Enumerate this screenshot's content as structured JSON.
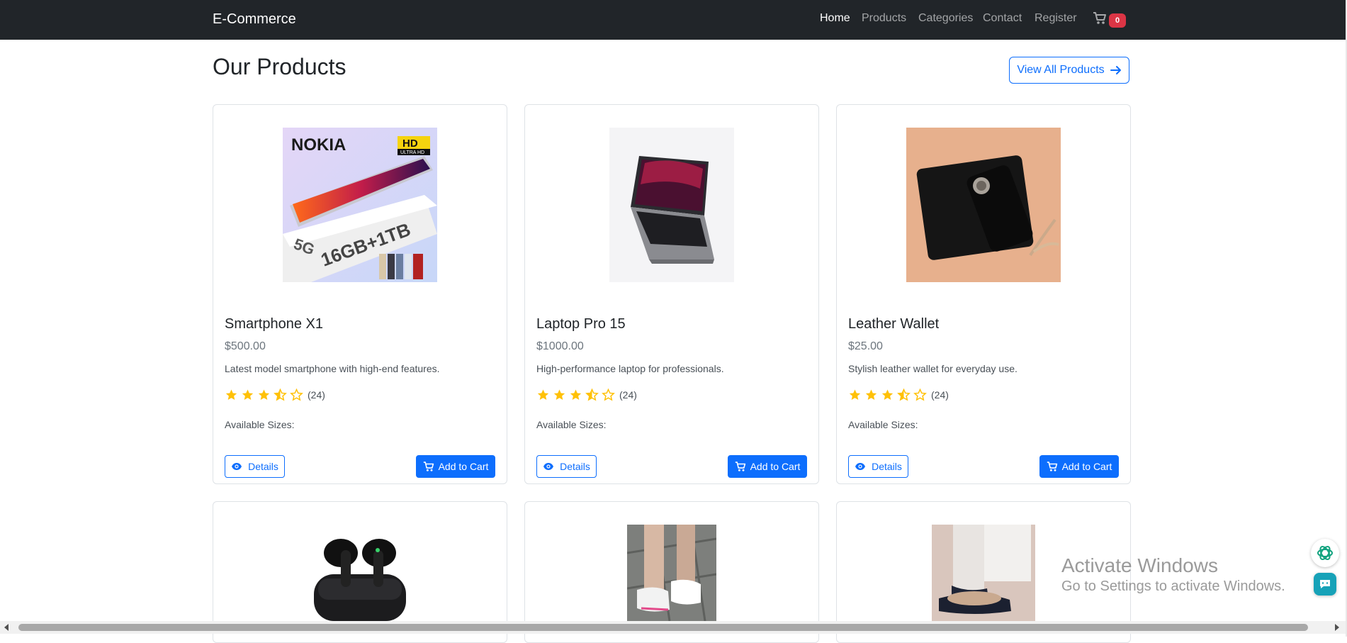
{
  "navbar": {
    "brand": "E-Commerce",
    "links": [
      {
        "label": "Home"
      },
      {
        "label": "Products"
      },
      {
        "label": "Categories"
      },
      {
        "label": "Contact"
      },
      {
        "label": "Register"
      }
    ],
    "cart_count": "0"
  },
  "header": {
    "title": "Our Products",
    "view_all_label": "View All Products"
  },
  "products": [
    {
      "name": "Smartphone X1",
      "price": "$500.00",
      "description": "Latest model smartphone with high-end features.",
      "rating": 3.5,
      "rating_count": "(24)",
      "sizes_label": "Available Sizes:",
      "details_label": "Details",
      "add_to_cart_label": "Add to Cart",
      "image": "smartphone",
      "image_text_brand": "NOKIA",
      "image_text_badge": "HD",
      "image_text_badge_sub": "ULTRA HD",
      "image_text_spec": "16GB+1TB",
      "image_text_net": "5G"
    },
    {
      "name": "Laptop Pro 15",
      "price": "$1000.00",
      "description": "High-performance laptop for professionals.",
      "rating": 3.5,
      "rating_count": "(24)",
      "sizes_label": "Available Sizes:",
      "details_label": "Details",
      "add_to_cart_label": "Add to Cart",
      "image": "laptop"
    },
    {
      "name": "Leather Wallet",
      "price": "$25.00",
      "description": "Stylish leather wallet for everyday use.",
      "rating": 3.5,
      "rating_count": "(24)",
      "sizes_label": "Available Sizes:",
      "details_label": "Details",
      "add_to_cart_label": "Add to Cart",
      "image": "wallet"
    },
    {
      "image": "earbuds"
    },
    {
      "image": "sneakers"
    },
    {
      "image": "sandals"
    }
  ],
  "os_overlay": {
    "title": "Activate Windows",
    "subtitle": "Go to Settings to activate Windows."
  },
  "colors": {
    "navbar": "#212529",
    "primary": "#0d6efd",
    "badge": "#dc3545",
    "star": "#ffc107"
  }
}
